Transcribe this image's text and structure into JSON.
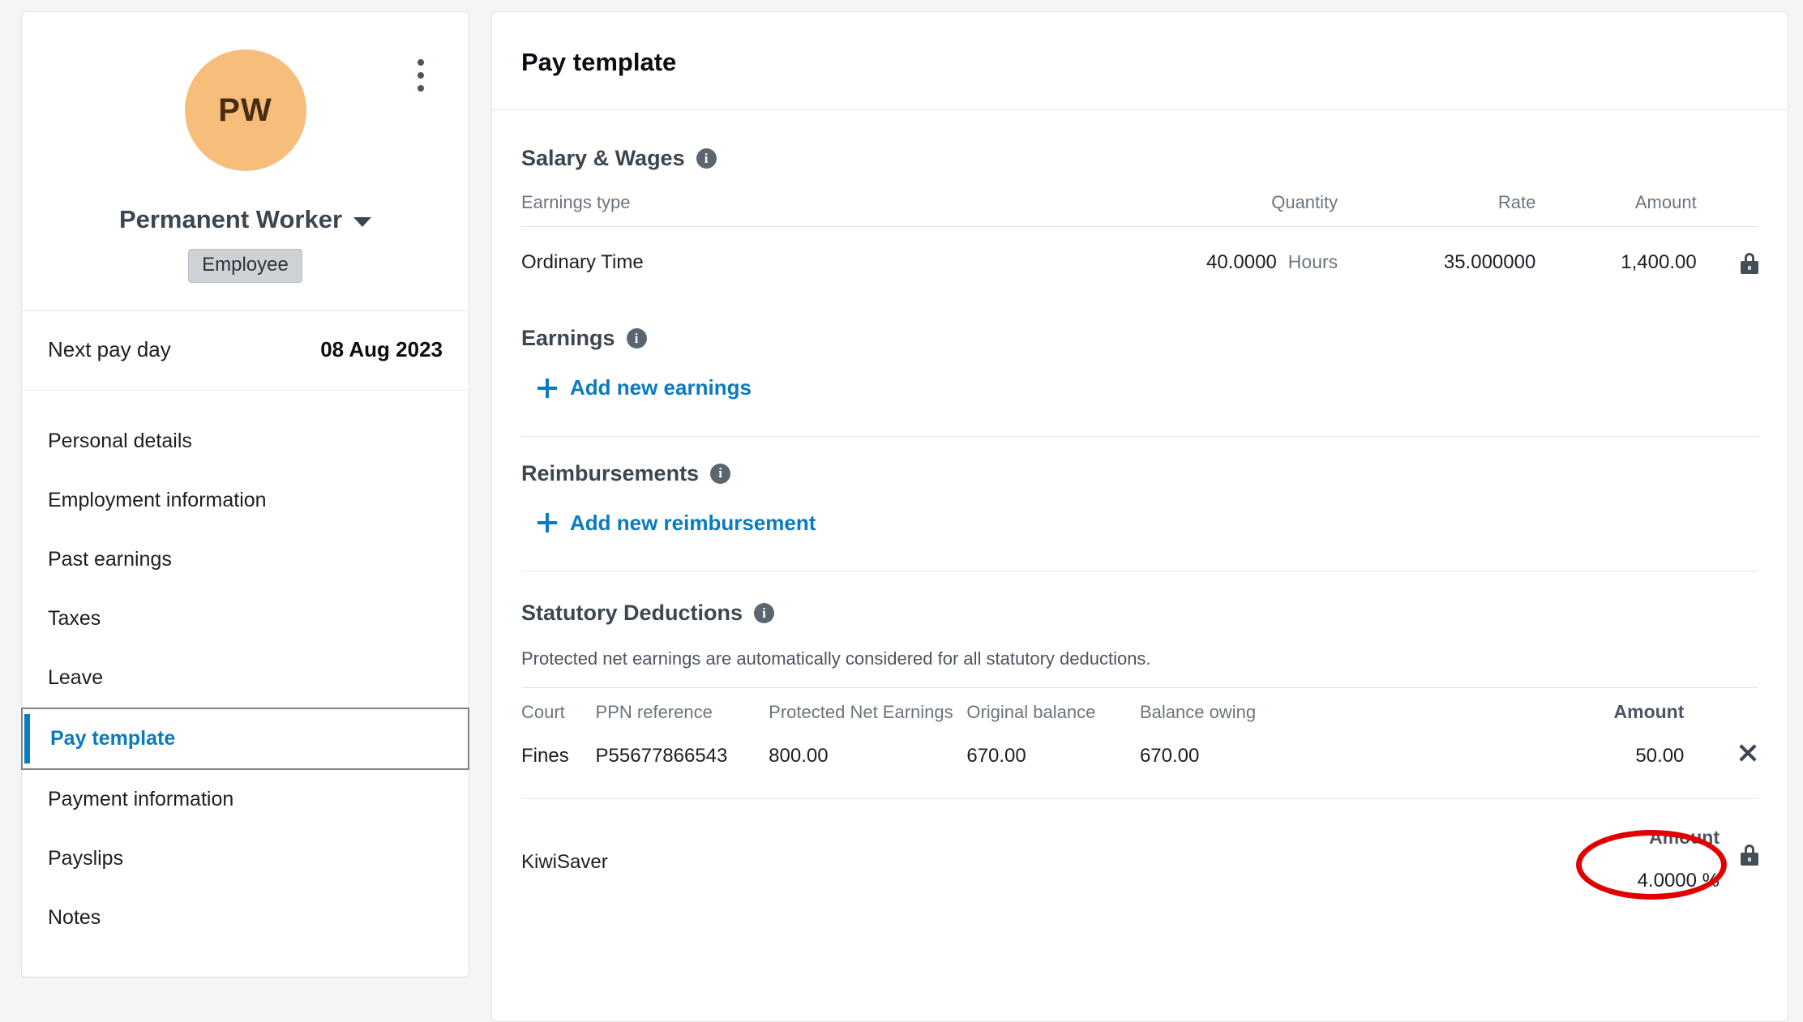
{
  "employee_card": {
    "avatar_initials": "PW",
    "name": "Permanent Worker",
    "role_badge": "Employee",
    "next_pay_day_label": "Next pay day",
    "next_pay_day_value": "08 Aug 2023",
    "nav_items": [
      {
        "label": "Personal details",
        "active": false
      },
      {
        "label": "Employment information",
        "active": false
      },
      {
        "label": "Past earnings",
        "active": false
      },
      {
        "label": "Taxes",
        "active": false
      },
      {
        "label": "Leave",
        "active": false
      },
      {
        "label": "Pay template",
        "active": true
      },
      {
        "label": "Payment information",
        "active": false
      },
      {
        "label": "Payslips",
        "active": false
      },
      {
        "label": "Notes",
        "active": false
      }
    ]
  },
  "panel": {
    "title": "Pay template",
    "salary_wages": {
      "heading": "Salary & Wages",
      "info_glyph": "i",
      "columns": [
        "Earnings type",
        "Quantity",
        "Rate",
        "Amount"
      ],
      "rows": [
        {
          "earnings_type": "Ordinary Time",
          "quantity": "40.0000",
          "unit": "Hours",
          "rate": "35.000000",
          "amount": "1,400.00",
          "locked": true
        }
      ]
    },
    "earnings": {
      "heading": "Earnings",
      "add_label": "Add new earnings"
    },
    "reimbursements": {
      "heading": "Reimbursements",
      "add_label": "Add new reimbursement"
    },
    "statutory_deductions": {
      "heading": "Statutory Deductions",
      "note": "Protected net earnings are automatically considered for all statutory deductions.",
      "columns": [
        "Court",
        "PPN reference",
        "Protected Net Earnings",
        "Original balance",
        "Balance owing",
        "Amount"
      ],
      "rows": [
        {
          "court": "Fines",
          "ppn_reference": "P55677866543",
          "protected_net_earnings": "800.00",
          "original_balance": "670.00",
          "balance_owing": "670.00",
          "amount": "50.00"
        }
      ],
      "kiwisaver": {
        "name": "KiwiSaver",
        "amount_header": "Amount",
        "amount_value": "4.0000 %",
        "locked": true
      }
    }
  },
  "annotation": {
    "type": "ellipse-highlight",
    "color": "#e00000",
    "targets": "deduction-amount-50.00"
  },
  "colors": {
    "accent_link": "#0a7bbd",
    "avatar_bg": "#f7bd7b",
    "heading": "#3c4650",
    "annotation_red": "#e00000",
    "page_bg": "#f4f5f6"
  }
}
